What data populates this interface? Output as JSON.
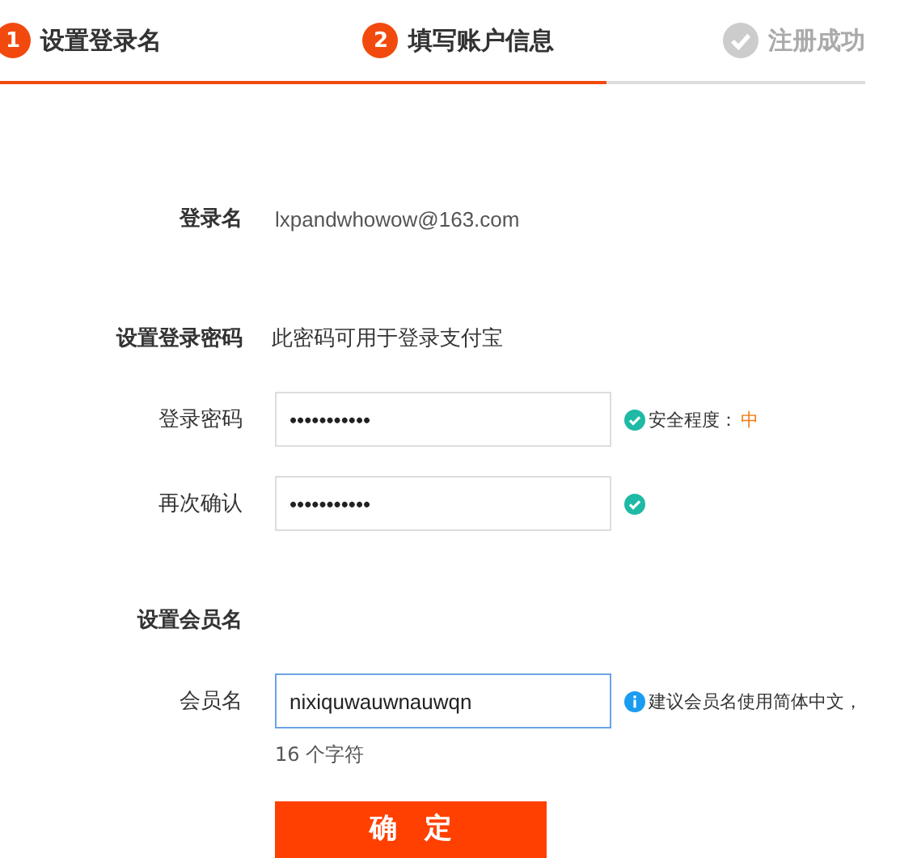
{
  "steps": [
    {
      "number": "1",
      "label": "设置登录名",
      "kind": "numbered"
    },
    {
      "number": "2",
      "label": "填写账户信息",
      "kind": "numbered"
    },
    {
      "label": "注册成功",
      "kind": "checkmark"
    }
  ],
  "progress": {
    "level": 0.7
  },
  "form": [
    {
      "kind": "static",
      "label": "登录名",
      "value": "lxpandwhowow@163.com"
    },
    {
      "kind": "section",
      "label": "设置登录密码",
      "note": "此密码可用于登录支付宝"
    },
    {
      "kind": "field",
      "label": "登录密码",
      "value": "•••••••••••",
      "focused": false,
      "tip": {
        "kind": "check",
        "text": "安全程度：",
        "level_text": "中"
      }
    },
    {
      "kind": "field",
      "label": "再次确认",
      "value": "•••••••••••",
      "focused": false,
      "tip": {
        "kind": "check"
      }
    },
    {
      "kind": "section",
      "label": "设置会员名"
    },
    {
      "kind": "field",
      "label": "会员名",
      "value": "nixiquwauwnauwqn",
      "focused": true,
      "tip": {
        "kind": "info",
        "text": "建议会员名使用简体中文，"
      },
      "count": "16 个字符"
    }
  ],
  "submit": "确　定"
}
